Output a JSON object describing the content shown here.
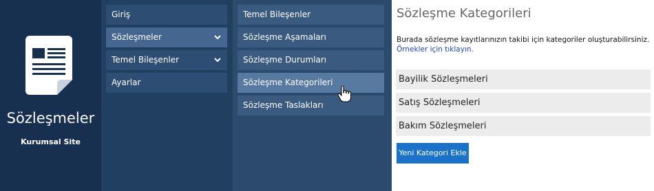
{
  "brand": {
    "title": "Sözleşmeler",
    "subtitle": "Kurumsal Site",
    "icon": "document-icon"
  },
  "nav": {
    "items": [
      {
        "label": "Giriş"
      },
      {
        "label": "Sözleşmeler",
        "icon": "chevron-down-icon"
      },
      {
        "label": "Temel Bileşenler",
        "icon": "chevron-down-icon"
      },
      {
        "label": "Ayarlar"
      }
    ],
    "active_index": 1
  },
  "subnav": {
    "items": [
      {
        "label": "Temel Bileşenler"
      },
      {
        "label": "Sözleşme Aşamaları"
      },
      {
        "label": "Sözleşme Durumları"
      },
      {
        "label": "Sözleşme Kategorileri"
      },
      {
        "label": "Sözleşme Taslakları"
      }
    ],
    "active_index": 3
  },
  "content": {
    "title": "Sözleşme Kategorileri",
    "description": "Burada sözleşme kayıtlarınızın takibi için kategoriler oluşturabilirsiniz.",
    "link": "Örnekler için tıklayın.",
    "categories": [
      {
        "label": "Bayilik Sözleşmeleri"
      },
      {
        "label": "Satış Sözleşmeleri"
      },
      {
        "label": "Bakım Sözleşmeleri"
      }
    ],
    "add_button": "Yeni Kategori Ekle"
  },
  "colors": {
    "brand_bg": "#17304f",
    "nav_bg": "#213f61",
    "subnav_bg": "#2b4a6d",
    "button": "#1a73c8",
    "link": "#1a43c9"
  }
}
